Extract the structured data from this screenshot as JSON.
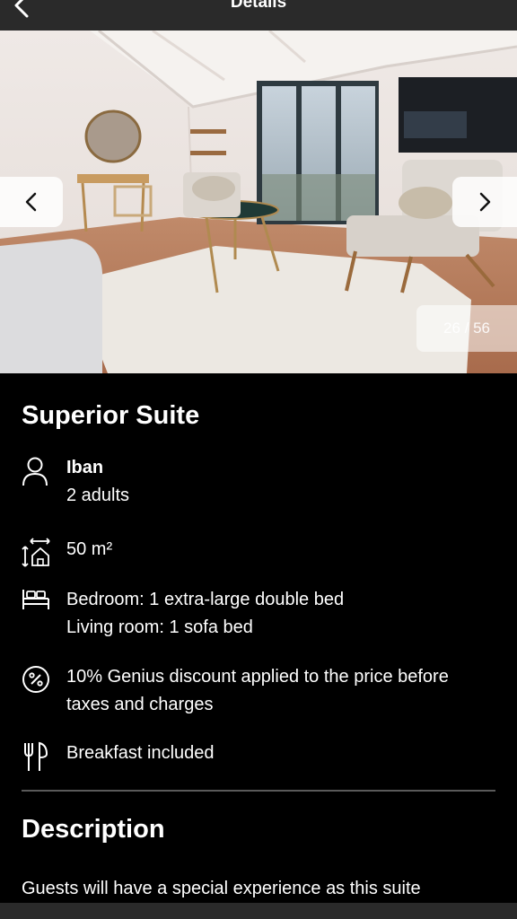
{
  "header": {
    "title": "Details",
    "back_icon": "chevron-left-icon"
  },
  "gallery": {
    "counter": "26 / 56",
    "prev_icon": "chevron-left-icon",
    "next_icon": "chevron-right-icon"
  },
  "room": {
    "title": "Superior Suite",
    "guests": {
      "name": "Iban",
      "occupancy": "2 adults"
    },
    "size": "50 m²",
    "beds": {
      "line1": "Bedroom: 1 extra-large double bed",
      "line2": "Living room: 1 sofa bed"
    },
    "discount": {
      "line1": "10% Genius discount applied to the price before",
      "line2": "taxes and charges"
    },
    "breakfast": "Breakfast included"
  },
  "description": {
    "title": "Description",
    "text": "Guests will have a special experience as this suite"
  }
}
